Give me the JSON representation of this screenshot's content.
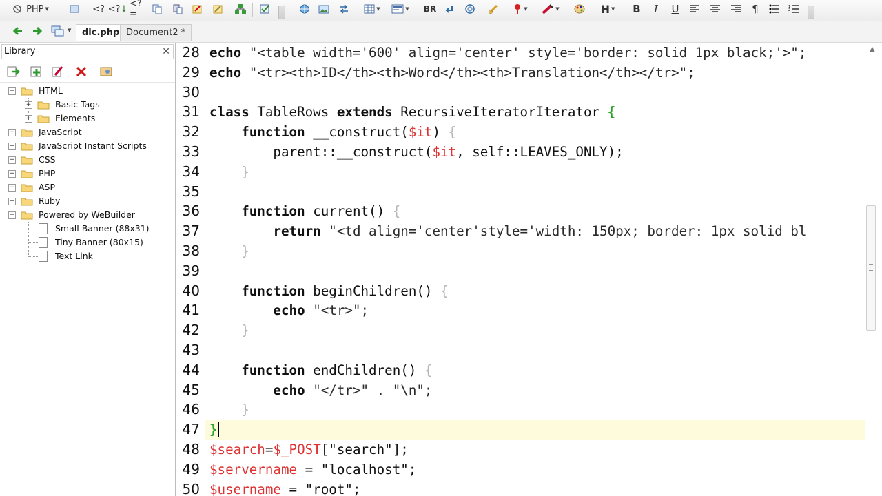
{
  "toolbar": {
    "php_label": "PHP",
    "br_label": "BR",
    "h_label": "H",
    "bold_label": "B",
    "italic_label": "I",
    "underline_label": "U",
    "pilcrow_label": "¶"
  },
  "tabs": {
    "active": "dic.php",
    "second": "Document2 *"
  },
  "library": {
    "title": "Library",
    "close": "✕",
    "tree": {
      "html": "HTML",
      "basic_tags": "Basic Tags",
      "elements": "Elements",
      "javascript": "JavaScript",
      "js_instant": "JavaScript Instant Scripts",
      "css": "CSS",
      "php": "PHP",
      "asp": "ASP",
      "ruby": "Ruby",
      "powered": "Powered by WeBuilder",
      "small_banner": "Small Banner (88x31)",
      "tiny_banner": "Tiny Banner (80x15)",
      "text_link": "Text Link"
    }
  },
  "editor": {
    "lines": [
      {
        "n": "28",
        "parts": [
          [
            "kw",
            "echo"
          ],
          [
            "str",
            " \"<table width='600' align='center' style='border: solid 1px black;'>\";"
          ]
        ]
      },
      {
        "n": "29",
        "parts": [
          [
            "kw",
            "echo"
          ],
          [
            "str",
            " \"<tr><th>ID</th><th>Word</th><th>Translation</th></tr>\";"
          ]
        ]
      },
      {
        "n": "30",
        "parts": []
      },
      {
        "n": "31",
        "parts": [
          [
            "kw",
            "class"
          ],
          [
            "plain",
            " TableRows "
          ],
          [
            "kw",
            "extends"
          ],
          [
            "plain",
            " RecursiveIteratorIterator "
          ],
          [
            "brace-y",
            "{"
          ]
        ]
      },
      {
        "n": "32",
        "parts": [
          [
            "plain",
            "    "
          ],
          [
            "kw",
            "function"
          ],
          [
            "plain",
            " __construct("
          ],
          [
            "var",
            "$it"
          ],
          [
            "plain",
            ") "
          ],
          [
            "grey",
            "{"
          ]
        ]
      },
      {
        "n": "33",
        "parts": [
          [
            "plain",
            "        parent::__construct("
          ],
          [
            "var",
            "$it"
          ],
          [
            "plain",
            ", self::LEAVES_ONLY);"
          ]
        ]
      },
      {
        "n": "34",
        "parts": [
          [
            "plain",
            "    "
          ],
          [
            "grey",
            "}"
          ]
        ]
      },
      {
        "n": "35",
        "parts": []
      },
      {
        "n": "36",
        "parts": [
          [
            "plain",
            "    "
          ],
          [
            "kw",
            "function"
          ],
          [
            "plain",
            " current() "
          ],
          [
            "grey",
            "{"
          ]
        ]
      },
      {
        "n": "37",
        "parts": [
          [
            "plain",
            "        "
          ],
          [
            "kw",
            "return"
          ],
          [
            "str",
            " \"<td align='center'style='width: 150px; border: 1px solid bl"
          ]
        ]
      },
      {
        "n": "38",
        "parts": [
          [
            "plain",
            "    "
          ],
          [
            "grey",
            "}"
          ]
        ]
      },
      {
        "n": "39",
        "parts": []
      },
      {
        "n": "40",
        "parts": [
          [
            "plain",
            "    "
          ],
          [
            "kw",
            "function"
          ],
          [
            "plain",
            " beginChildren() "
          ],
          [
            "grey",
            "{"
          ]
        ]
      },
      {
        "n": "41",
        "parts": [
          [
            "plain",
            "        "
          ],
          [
            "kw",
            "echo"
          ],
          [
            "str",
            " \"<tr>\";"
          ]
        ]
      },
      {
        "n": "42",
        "parts": [
          [
            "plain",
            "    "
          ],
          [
            "grey",
            "}"
          ]
        ]
      },
      {
        "n": "43",
        "parts": []
      },
      {
        "n": "44",
        "parts": [
          [
            "plain",
            "    "
          ],
          [
            "kw",
            "function"
          ],
          [
            "plain",
            " endChildren() "
          ],
          [
            "grey",
            "{"
          ]
        ]
      },
      {
        "n": "45",
        "parts": [
          [
            "plain",
            "        "
          ],
          [
            "kw",
            "echo"
          ],
          [
            "str",
            " \"</tr>\" . \"\\n\";"
          ]
        ]
      },
      {
        "n": "46",
        "parts": [
          [
            "plain",
            "    "
          ],
          [
            "grey",
            "}"
          ]
        ]
      },
      {
        "n": "47",
        "parts": [
          [
            "brace-y",
            "}"
          ]
        ]
      },
      {
        "n": "48",
        "parts": [
          [
            "var",
            "$search"
          ],
          [
            "plain",
            "="
          ],
          [
            "var",
            "$_POST"
          ],
          [
            "plain",
            "[\"search\"];"
          ]
        ]
      },
      {
        "n": "49",
        "parts": [
          [
            "var",
            "$servername"
          ],
          [
            "plain",
            " = \"localhost\";"
          ]
        ]
      },
      {
        "n": "50",
        "parts": [
          [
            "var",
            "$username"
          ],
          [
            "plain",
            " = \"root\";"
          ]
        ]
      }
    ]
  }
}
